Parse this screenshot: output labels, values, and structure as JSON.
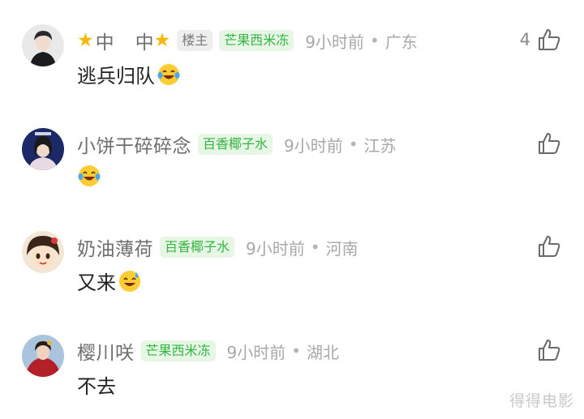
{
  "comments": [
    {
      "username": "中中",
      "owner_tag": "楼主",
      "group_tag": "芒果西米冻",
      "time": "9小时前",
      "region": "广东",
      "likes": "4",
      "text": "逃兵归队",
      "emoji": "laughing-tears"
    },
    {
      "username": "小饼干碎碎念",
      "group_tag": "百香椰子水",
      "time": "9小时前",
      "region": "江苏",
      "text": "",
      "emoji": "laughing-tears"
    },
    {
      "username": "奶油薄荷",
      "group_tag": "百香椰子水",
      "time": "9小时前",
      "region": "河南",
      "text": "又来",
      "emoji": "sweat-smile"
    },
    {
      "username": "樱川咲",
      "group_tag": "芒果西米冻",
      "time": "9小时前",
      "region": "湖北",
      "text": "不去"
    }
  ],
  "watermark": "得得电影",
  "colors": {
    "group_tag_text": "#34b543",
    "group_tag_bg": "#e8f6e6",
    "star": "#f6b60a"
  }
}
